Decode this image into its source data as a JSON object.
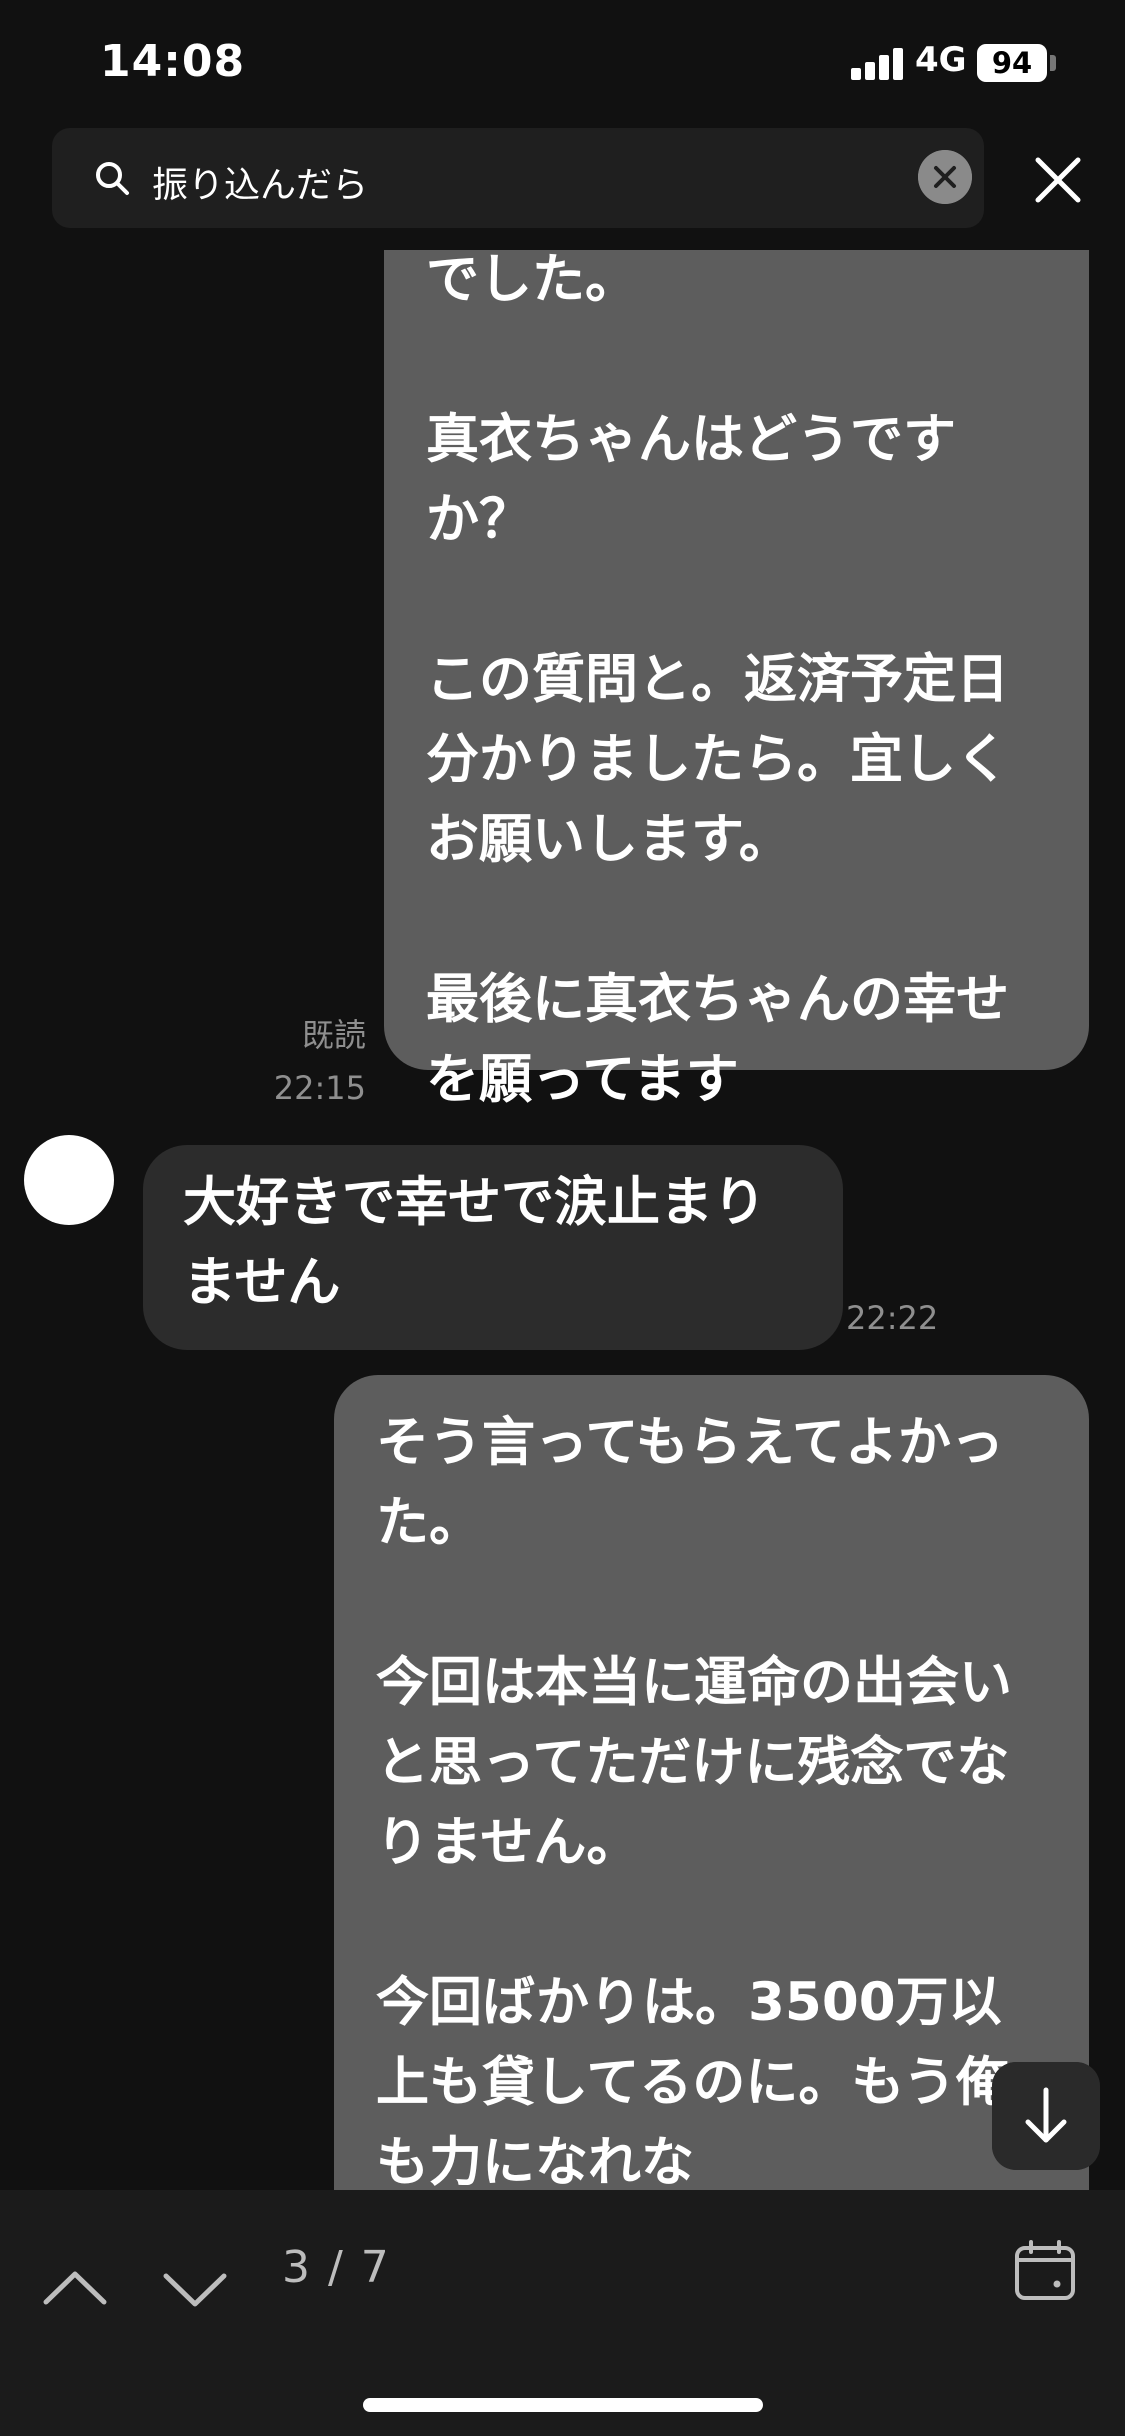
{
  "status_bar": {
    "time": "14:08",
    "network": "4G",
    "battery": "94"
  },
  "search": {
    "query": "振り込んだら"
  },
  "messages": {
    "first_outgoing": "でした。\n\n真衣ちゃんはどうですか？\n\nこの質問と。返済予定日分かりましたら。宜しくお願いします。\n\n最後に真衣ちゃんの幸せを願ってます",
    "first_read": "既読",
    "first_time": "22:15",
    "incoming": "大好きで幸せで涙止まりません",
    "incoming_time": "22:22",
    "second_outgoing": "そう言ってもらえてよかった。\n\n今回は本当に運命の出会いと思ってただけに残念でなりません。\n\n今回ばかりは。3500万以上も貸してるのに。もう俺も力になれな"
  },
  "bottom": {
    "counter": "3 / 7"
  },
  "icons": {
    "search": "search-icon",
    "clear": "clear-icon",
    "close": "close-icon",
    "scroll": "arrow-down-icon",
    "up": "chevron-up-icon",
    "down": "chevron-down-icon",
    "calendar": "calendar-icon"
  },
  "colors": {
    "background": "#111111",
    "outgoing_bubble": "#5d5d5d",
    "incoming_bubble": "#2c2c2c"
  }
}
